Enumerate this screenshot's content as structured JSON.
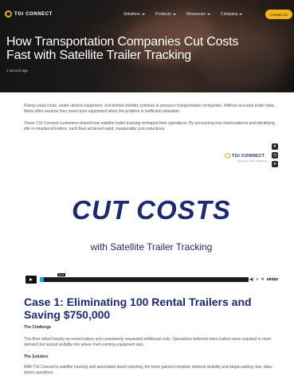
{
  "nav": {
    "logo_text": "TGI CONNECT",
    "links": [
      "Solutions",
      "Products",
      "Resources",
      "Company"
    ],
    "contact_label": "Contact us"
  },
  "hero": {
    "title": "How Transportation Companies Cut Costs Fast with Satellite Trailer Tracking",
    "timestamp": "1 second ago"
  },
  "article": {
    "intro_1": "Rising rental costs, under-utilized equipment, and limited visibility continue to pressure transportation companies. Without accurate trailer data, fleets often assume they need more equipment when the problem is inefficient utilization.",
    "intro_2": "These TGI Connect customers shared how satellite trailer tracking reshaped their operations. By uncovering true dwell patterns and identifying idle or misplaced trailers, each fleet achieved rapid, measurable cost reductions."
  },
  "video": {
    "logo_text": "TGI CONNECT",
    "logo_sub": "Gateway to trailer intelligence",
    "headline": "CUT COSTS",
    "subheadline": "with Satellite Trailer Tracking",
    "time_label": "00:00",
    "progress": 0.01,
    "vimeo_label": "vimeo",
    "side_icons": [
      "heart-icon",
      "clock-icon",
      "send-icon"
    ]
  },
  "case1": {
    "title": "Case 1: Eliminating 100 Rental Trailers and Saving $750,000",
    "challenge_head": "The Challenge",
    "challenge_text": "This fleet relied heavily on rental trailers and consistently requested additional units. Operations believed more trailers were required to meet demand but lacked visibility into where their existing equipment was.",
    "solution_head": "The Solution",
    "solution_text": "With TGI Connect's satellite tracking and automated dwell reporting, the team gained complete network visibility and began asking new, data-driven questions."
  },
  "colors": {
    "accent": "#f1b51c",
    "brand_navy": "#1e2a6e",
    "progress": "#00adef"
  }
}
